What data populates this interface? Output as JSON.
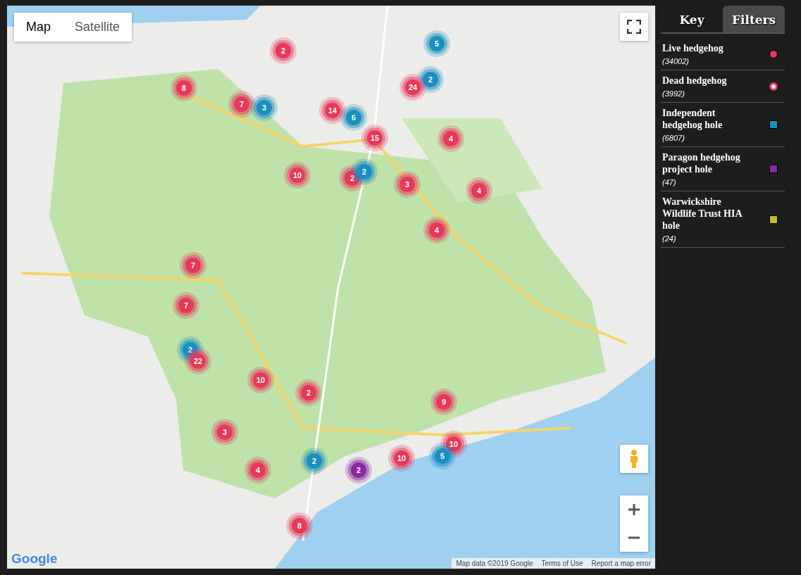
{
  "map": {
    "type_control": [
      {
        "label": "Map",
        "selected": true
      },
      {
        "label": "Satellite",
        "selected": false
      }
    ],
    "clusters": [
      {
        "count": "2",
        "kind": "live"
      },
      {
        "count": "5",
        "kind": "hole"
      },
      {
        "count": "8",
        "kind": "live"
      },
      {
        "count": "2",
        "kind": "hole"
      },
      {
        "count": "24",
        "kind": "live"
      },
      {
        "count": "7",
        "kind": "live"
      },
      {
        "count": "3",
        "kind": "hole"
      },
      {
        "count": "14",
        "kind": "live"
      },
      {
        "count": "6",
        "kind": "hole"
      },
      {
        "count": "15",
        "kind": "live"
      },
      {
        "count": "4",
        "kind": "live"
      },
      {
        "count": "10",
        "kind": "live"
      },
      {
        "count": "2",
        "kind": "live"
      },
      {
        "count": "2",
        "kind": "hole"
      },
      {
        "count": "3",
        "kind": "live"
      },
      {
        "count": "4",
        "kind": "live"
      },
      {
        "count": "4",
        "kind": "live"
      },
      {
        "count": "7",
        "kind": "live"
      },
      {
        "count": "7",
        "kind": "live"
      },
      {
        "count": "2",
        "kind": "hole"
      },
      {
        "count": "22",
        "kind": "live"
      },
      {
        "count": "10",
        "kind": "live"
      },
      {
        "count": "2",
        "kind": "live"
      },
      {
        "count": "9",
        "kind": "live"
      },
      {
        "count": "3",
        "kind": "live"
      },
      {
        "count": "10",
        "kind": "live"
      },
      {
        "count": "2",
        "kind": "hole"
      },
      {
        "count": "10",
        "kind": "live"
      },
      {
        "count": "5",
        "kind": "hole"
      },
      {
        "count": "4",
        "kind": "live"
      },
      {
        "count": "2",
        "kind": "paragon"
      },
      {
        "count": "8",
        "kind": "live"
      }
    ],
    "logo": "Google",
    "attribution": [
      "Map data ©2019 Google",
      "Terms of Use",
      "Report a map error"
    ]
  },
  "tabs": [
    {
      "label": "Key",
      "selected": true
    },
    {
      "label": "Filters",
      "selected": false
    }
  ],
  "legend": [
    {
      "label": "Live hedgehog",
      "count": "(34002)",
      "kind": "circle",
      "color": "#e8385a"
    },
    {
      "label": "Dead hedgehog",
      "count": "(3992)",
      "kind": "ring",
      "color": "#e8385a"
    },
    {
      "label": "Independent hedgehog hole",
      "count": "(6807)",
      "kind": "square",
      "color": "#1a8fc0"
    },
    {
      "label": "Paragon hedgehog project hole",
      "count": "(47)",
      "kind": "square",
      "color": "#8a2aa0"
    },
    {
      "label": "Warwickshire Wildlife Trust HIA hole",
      "count": "(24)",
      "kind": "square",
      "color": "#c8c020"
    }
  ]
}
